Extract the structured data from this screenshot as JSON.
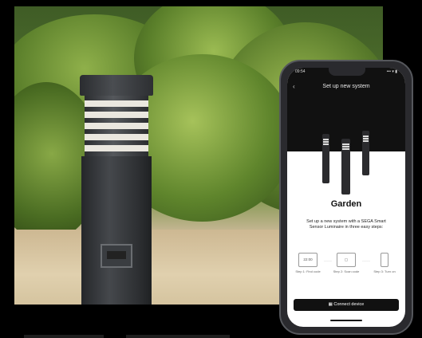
{
  "phone": {
    "status_time": "09:54",
    "status_right": "••• ▾ ▮",
    "back_icon": "chevron-left-icon",
    "title": "Set up new system",
    "heading": "Garden",
    "description": "Set up a new system with a SEGA Smart Sensor Luminaire in three easy steps:",
    "steps": [
      {
        "icon_text": "22:00",
        "label": "Step 1: Find code"
      },
      {
        "icon_text": "▢",
        "label": "Step 2: Scan code"
      },
      {
        "icon_text": "",
        "label": "Step 3: Turn on"
      }
    ],
    "connect_label": "Connect device",
    "connect_icon": "qr-icon"
  }
}
